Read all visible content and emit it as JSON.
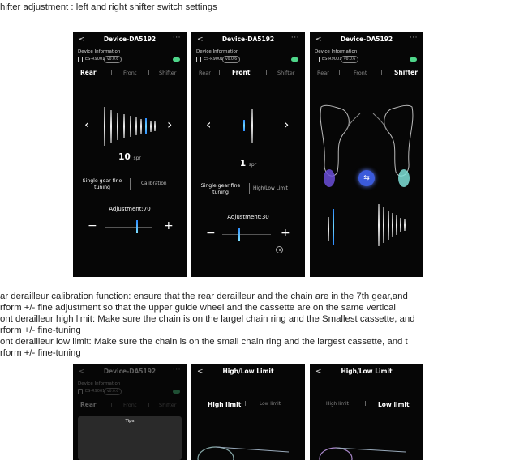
{
  "doc": {
    "heading": "hifter adjustment : left and right shifter switch settings",
    "para1": "ar derailleur calibration function: ensure that the rear derailleur and the chain are in the 7th gear,and",
    "para2": "rform +/- fine adjustment so that the upper guide wheel and the cassette are on the same vertical",
    "para3": "ont derailleur high limit: Make sure the chain is on the largel chain ring and the Smallest cassette, and",
    "para4": "rform +/- fine-tuning",
    "para5": "ont derailleur low limit: Make sure the chain is on the small chain ring and the largest cassette, and t",
    "para6": "rform +/- fine-tuning"
  },
  "device": {
    "title": "Device-DA5192",
    "info_label": "Device Information",
    "model": "ES-R9001",
    "version": "v0.0.6",
    "back": "<",
    "more": "···"
  },
  "tabs": {
    "rear": "Rear",
    "front": "Front",
    "shifter": "Shifter"
  },
  "screen1": {
    "value": "10",
    "unit": "spr",
    "option_left": "Single gear fine tuning",
    "option_right": "Calibration",
    "adjustment": "Adjustment:70",
    "minus": "−",
    "plus": "+",
    "left_arrow": "‹",
    "right_arrow": "›"
  },
  "screen2": {
    "value": "1",
    "unit": "spr",
    "option_left": "Single gear fine tuning",
    "option_right": "High/Low Limit",
    "adjustment": "Adjustment:30",
    "minus": "−",
    "plus": "+",
    "left_arrow": "‹",
    "right_arrow": "›"
  },
  "screen3": {
    "swap_icon": "⇆"
  },
  "screen4": {
    "tips_title": "Tips"
  },
  "limit": {
    "title": "High/Low Limit",
    "high": "High limit",
    "low": "Low limit",
    "back": "<"
  },
  "colors": {
    "accent": "#2a8aff",
    "toggle": "#4fd68a",
    "swap": "#3b5bdb"
  }
}
